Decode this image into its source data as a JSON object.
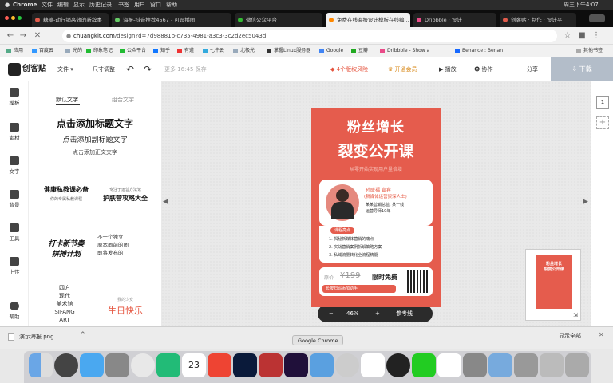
{
  "macbar": {
    "app": "Chrome",
    "menus": [
      "文件",
      "编辑",
      "显示",
      "历史记录",
      "书签",
      "用户",
      "窗口",
      "帮助"
    ],
    "clock": "周三下午4:07"
  },
  "tabs": [
    {
      "label": "糖糖-动行销高效的新辞事",
      "active": false
    },
    {
      "label": "海报-抖音推荐4567 - 可设播图",
      "active": false
    },
    {
      "label": "微信公众平台",
      "active": false
    },
    {
      "label": "免费在线海报设计模板在线编...",
      "active": true
    },
    {
      "label": "Dribbble · 设计",
      "active": false
    },
    {
      "label": "创客贴 · 制作 · 设计平",
      "active": false
    }
  ],
  "address": {
    "host": "chuangkit.com",
    "path": "/design?d=7d98881b-c735-4981-a3c3-3c2d2ec5043d"
  },
  "bookmarks": [
    "应用",
    "百度云",
    "光的",
    "印象笔记",
    "公众平台",
    "知乎",
    "有道",
    "七牛云",
    "北极光",
    "掌握Linux服务器",
    "Google",
    "豆瓣",
    "Dribbble - Show a",
    "Behance : Benan",
    "其他书签"
  ],
  "header": {
    "logo": "创客贴",
    "file_menu": "文件",
    "size_btn": "尺寸调整",
    "status": "更多 16:45 保存",
    "badge": "4个版权风险",
    "upgrade": "开通会员",
    "preview": "播放",
    "collab": "协作",
    "share": "分享",
    "download": "下载"
  },
  "sidebar": [
    {
      "label": "模板",
      "icon": "template-icon"
    },
    {
      "label": "素材",
      "icon": "material-icon"
    },
    {
      "label": "文字",
      "icon": "text-icon"
    },
    {
      "label": "背景",
      "icon": "background-icon"
    },
    {
      "label": "工具",
      "icon": "tool-icon"
    },
    {
      "label": "上传",
      "icon": "upload-icon"
    },
    {
      "label": "帮助",
      "icon": "help-icon"
    }
  ],
  "text_panel": {
    "tab_default": "默认文字",
    "tab_group": "组合文字",
    "add_title": "点击添加标题文字",
    "add_subtitle": "点击添加副标题文字",
    "add_body": "点击添加正文文字",
    "combo1_title": "健康私教课必备",
    "combo1_sub": "你的专属私教课程",
    "combo2_sub": "专注于运营方法论",
    "combo2_title": "护肤营攻略大全",
    "combo3": "打卡新节奏\n拼搏计划",
    "combo4": "不一个独立\n原本面前的图\n即将发布的",
    "combo5": "四方\n现代\n美术馆\nSIFANG\nART",
    "combo6_sub": "我的少女",
    "combo6": "生日快乐"
  },
  "poster": {
    "title1": "粉丝增长",
    "title2": "裂变公开课",
    "subtitle": "从零开始实现用户量倍增",
    "speaker_name": "孙联福 嘉宾",
    "speaker_title": "(新媒体运营资深人士)",
    "speaker_desc": "某某营销总监, 某一线\n运营导师10年",
    "section": "课程亮点",
    "points": [
      "1. 揭秘新媒体营销的痛点",
      "2. 实战营销案例拆解策略方案",
      "3. 私域流量转化全流程精髓"
    ],
    "price_old": "原价",
    "price_new": "¥199",
    "price_free": "限时免费",
    "contact": "长按扫码添加助手"
  },
  "zoom": {
    "value": "46%",
    "minus": "−",
    "plus": "+",
    "grid": "参考线"
  },
  "pages": {
    "current": "1",
    "add": "+"
  },
  "thumbnail": {
    "title": "粉丝增长\n裂变公开课"
  },
  "downloads": {
    "file": "演示海报.png",
    "show_all": "显示全部"
  },
  "dock": {
    "tooltip": "Google Chrome",
    "calendar_day": "23"
  }
}
